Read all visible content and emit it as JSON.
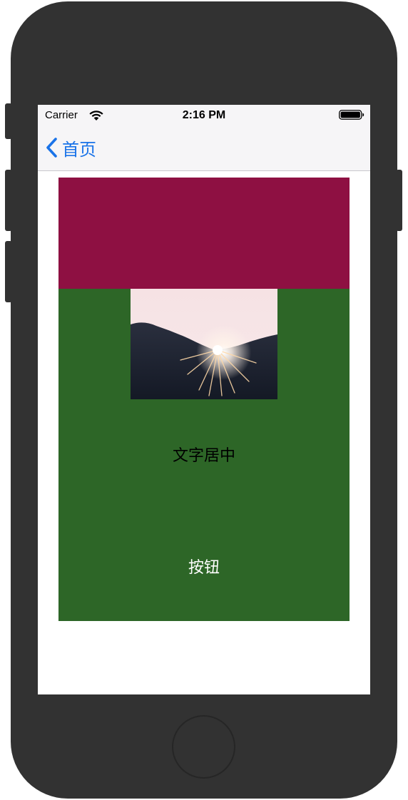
{
  "status_bar": {
    "carrier": "Carrier",
    "time": "2:16 PM",
    "wifi_icon": "wifi-icon",
    "battery_icon": "battery-full-icon"
  },
  "nav_bar": {
    "back_label": "首页",
    "back_icon": "chevron-left-icon",
    "accent_color": "#1a73e8"
  },
  "content": {
    "top_block_color": "#8e1042",
    "main_block_color": "#2d6627",
    "image_alt": "sunset-over-mountains",
    "centered_text": "文字居中",
    "button_label": "按钮"
  }
}
